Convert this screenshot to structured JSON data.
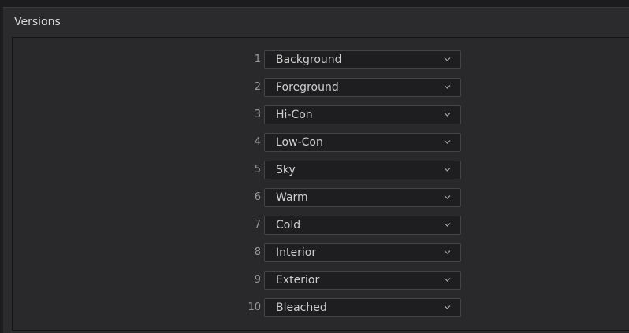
{
  "panel": {
    "title": "Versions"
  },
  "versions": [
    {
      "number": "1",
      "name": "Background"
    },
    {
      "number": "2",
      "name": "Foreground"
    },
    {
      "number": "3",
      "name": "Hi-Con"
    },
    {
      "number": "4",
      "name": "Low-Con"
    },
    {
      "number": "5",
      "name": "Sky"
    },
    {
      "number": "6",
      "name": "Warm"
    },
    {
      "number": "7",
      "name": "Cold"
    },
    {
      "number": "8",
      "name": "Interior"
    },
    {
      "number": "9",
      "name": "Exterior"
    },
    {
      "number": "10",
      "name": "Bleached"
    }
  ],
  "icons": {
    "dropdown": "chevron-down-icon"
  }
}
